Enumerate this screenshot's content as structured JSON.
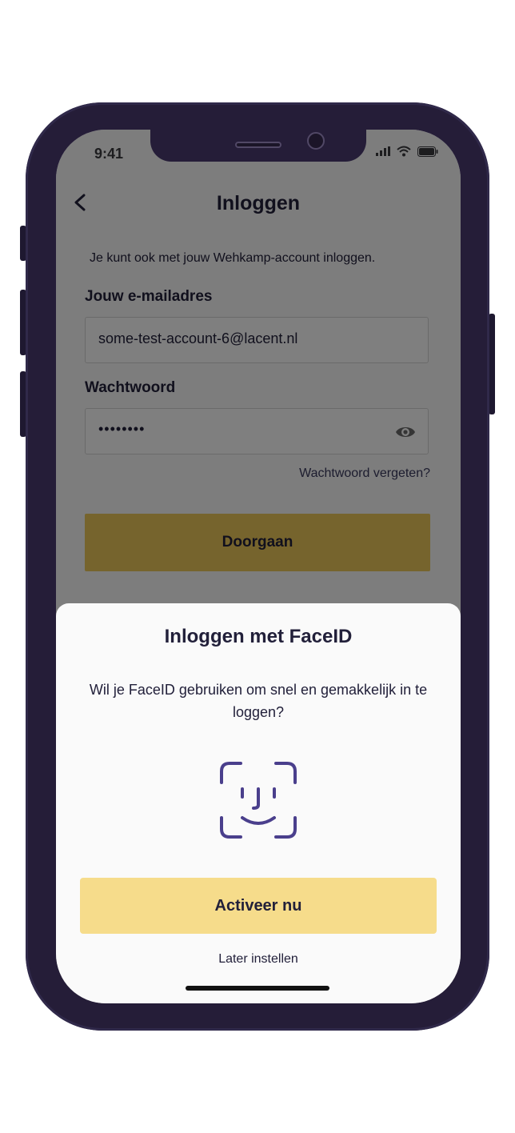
{
  "status_bar": {
    "time": "9:41"
  },
  "header": {
    "back_label": "",
    "title": "Inloggen"
  },
  "form": {
    "intro": "Je kunt ook met jouw Wehkamp-account inloggen.",
    "email_label": "Jouw e-mailadres",
    "email_value": "some-test-account-6@lacent.nl",
    "password_label": "Wachtwoord",
    "password_value": "••••••••",
    "forgot_link": "Wachtwoord vergeten?",
    "submit_label": "Doorgaan"
  },
  "sheet": {
    "title": "Inloggen met FaceID",
    "description": "Wil je FaceID gebruiken om snel en gemakkelijk in te loggen?",
    "icon": "faceid-icon",
    "activate_label": "Activeer nu",
    "later_label": "Later instellen"
  },
  "colors": {
    "primary": "#edc85a",
    "primary_light": "#f6dc8b",
    "icon_purple": "#4a3f8c",
    "phone_frame": "#251d38",
    "text": "#22203a"
  }
}
